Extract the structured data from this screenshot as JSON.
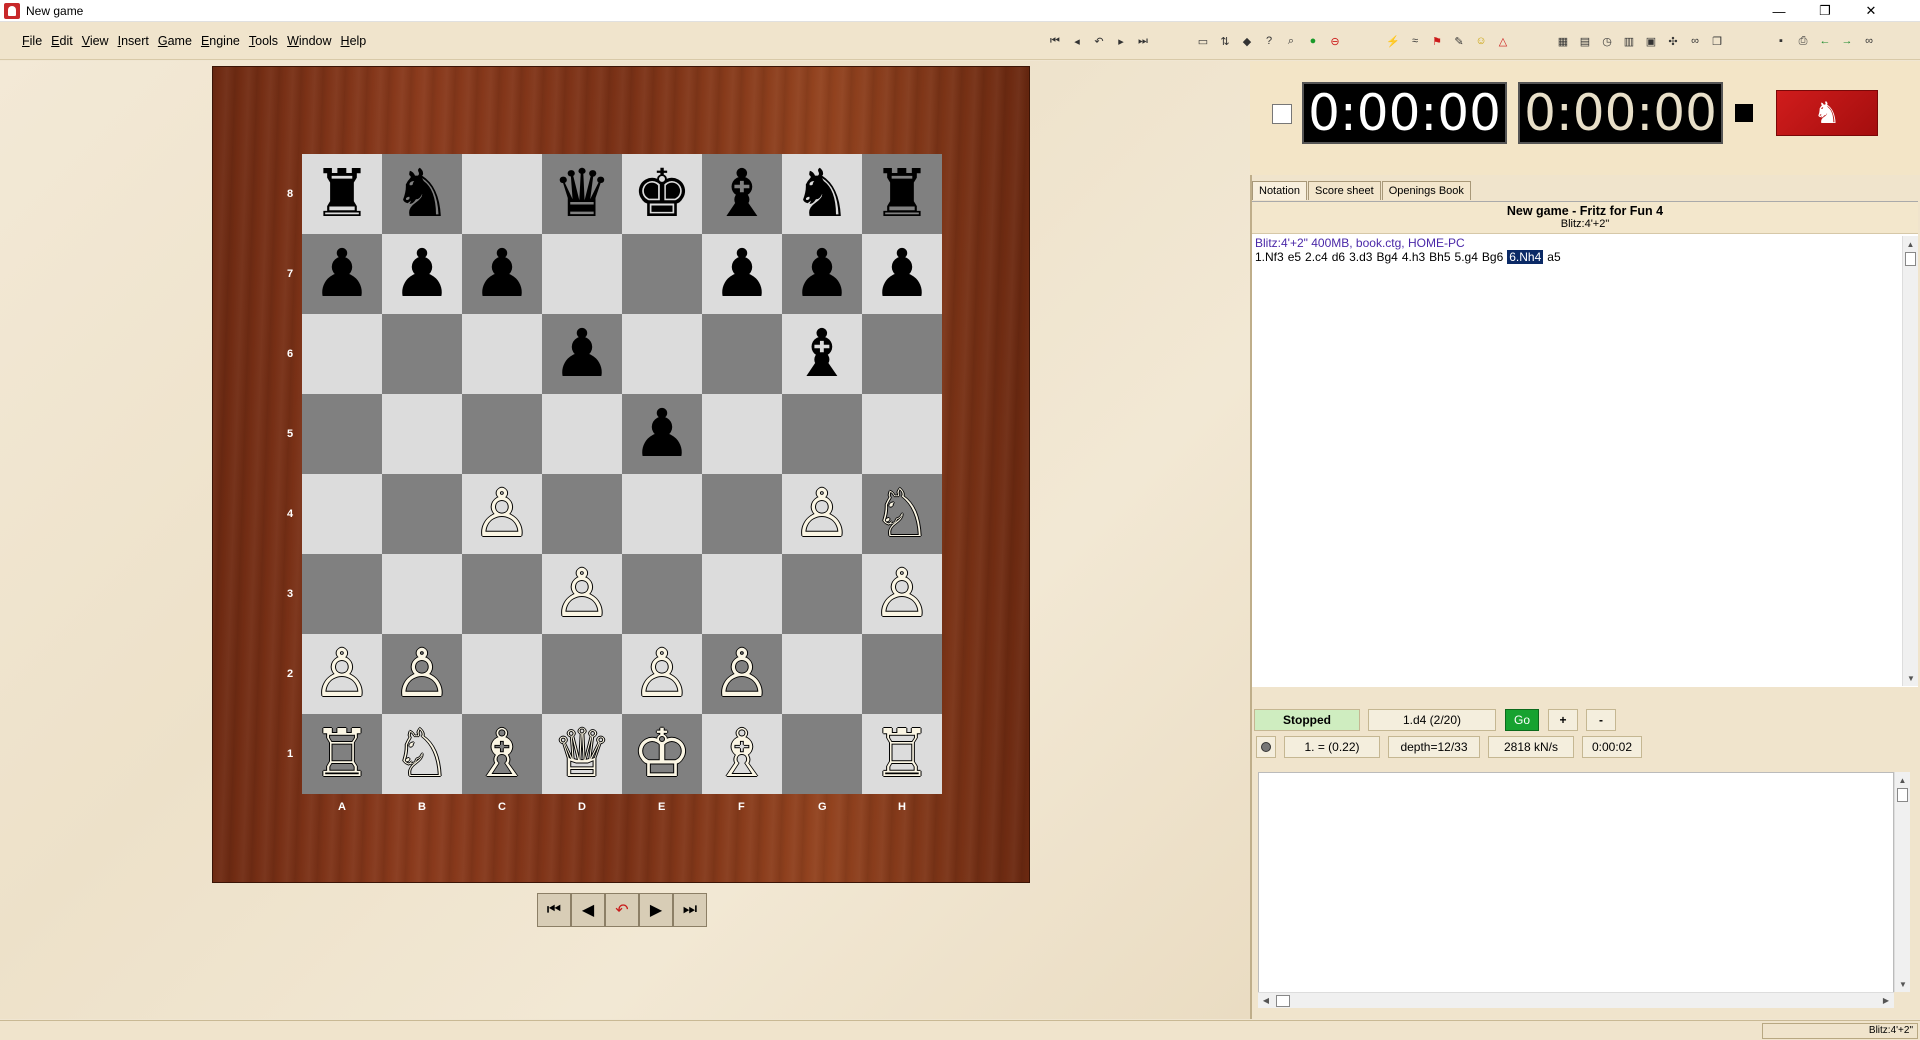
{
  "window": {
    "title": "New game",
    "controls": [
      "—",
      "❐",
      "✕"
    ]
  },
  "menu": [
    "File",
    "Edit",
    "View",
    "Insert",
    "Game",
    "Engine",
    "Tools",
    "Window",
    "Help"
  ],
  "toolbar": {
    "nav_icons": [
      "first-move-icon",
      "prev-move-icon",
      "takeback-icon",
      "next-move-icon",
      "last-move-icon"
    ],
    "game_icons": [
      "new-game-icon",
      "flip-icon",
      "hint-icon",
      "help-icon",
      "zoom-icon",
      "ok-icon",
      "stop-icon"
    ],
    "engine_icons": [
      "lightning-icon",
      "wave-icon",
      "flag-icon",
      "pen-icon",
      "smiley-icon",
      "triangle-icon"
    ],
    "window_icons": [
      "board-icon",
      "book-icon",
      "clock-icon",
      "table-icon",
      "screen-icon",
      "wrench-icon",
      "link-icon",
      "copy-icon"
    ],
    "file_icons": [
      "save-icon",
      "print-icon",
      "back-icon",
      "forward-icon",
      "binoculars-icon"
    ]
  },
  "board": {
    "ranks": [
      "8",
      "7",
      "6",
      "5",
      "4",
      "3",
      "2",
      "1"
    ],
    "files": [
      "A",
      "B",
      "C",
      "D",
      "E",
      "F",
      "G",
      "H"
    ],
    "position": [
      [
        "bR",
        "bN",
        "",
        "bQ",
        "bK",
        "bB",
        "bN",
        "bR"
      ],
      [
        "bP",
        "bP",
        "bP",
        "",
        "",
        "bP",
        "bP",
        "bP"
      ],
      [
        "",
        "",
        "",
        "bP",
        "",
        "",
        "bB",
        ""
      ],
      [
        "",
        "",
        "",
        "",
        "bP",
        "",
        "",
        ""
      ],
      [
        "",
        "",
        "wP",
        "",
        "",
        "",
        "wP",
        "wN"
      ],
      [
        "",
        "",
        "",
        "wP",
        "",
        "",
        "",
        "wP"
      ],
      [
        "wP",
        "wP",
        "",
        "",
        "wP",
        "wP",
        "",
        ""
      ],
      [
        "wR",
        "wN",
        "wB",
        "wQ",
        "wK",
        "wB",
        "",
        "wR"
      ]
    ],
    "glyphs": {
      "wK": "♔",
      "wQ": "♕",
      "wR": "♖",
      "wB": "♗",
      "wN": "♘",
      "wP": "♙",
      "bK": "♚",
      "bQ": "♛",
      "bR": "♜",
      "bB": "♝",
      "bN": "♞",
      "bP": "♟"
    },
    "light_color": "#dcdcdc",
    "dark_color": "#808080"
  },
  "nav_buttons": [
    "⏮",
    "◀",
    "↶",
    "▶",
    "⏭"
  ],
  "clocks": {
    "white": "0:00:00",
    "black": "0:00:00"
  },
  "logo_glyph": "♞",
  "tabs": [
    "Notation",
    "Score sheet",
    "Openings Book"
  ],
  "notation": {
    "title": "New game - Fritz for Fun 4",
    "subtitle": "Blitz:4'+2\"",
    "meta": "Blitz:4'+2\"  400MB, book.ctg, HOME-PC",
    "moves": [
      "1.Nf3",
      "e5",
      "2.c4",
      "d6",
      "3.d3",
      "Bg4",
      "4.h3",
      "Bh5",
      "5.g4",
      "Bg6",
      "6.Nh4",
      "a5"
    ],
    "current_index": 10
  },
  "engine": {
    "status": "Stopped",
    "best_move": "1.d4 (2/20)",
    "go": "Go",
    "plus": "+",
    "minus": "-",
    "eval": "1. = (0.22)",
    "depth": "depth=12/33",
    "speed": "2818 kN/s",
    "time": "0:00:02"
  },
  "statusbar": {
    "right": "Blitz:4'+2\""
  },
  "colors": {
    "accent_go": "#17a230",
    "stopped_bg": "#cfedc0",
    "current_move_bg": "#0b2a66",
    "meta_text": "#4a28a8",
    "logo_red": "#d01c1c"
  }
}
